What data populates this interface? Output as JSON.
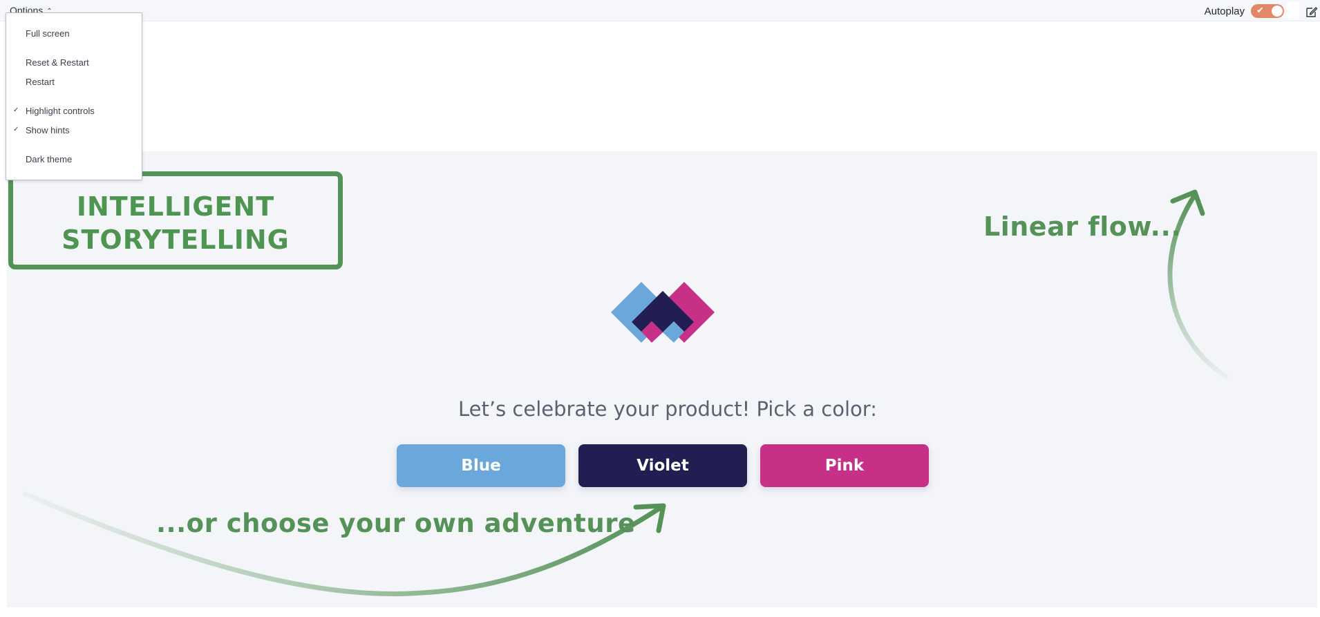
{
  "topbar": {
    "options_label": "Options",
    "chevron_icon": "chevron-up-icon",
    "autoplay_label": "Autoplay",
    "autoplay_on": true,
    "autoplay_check": "✔",
    "edit_icon": "edit-icon"
  },
  "menu": {
    "items": [
      {
        "label": "Full screen",
        "checked": false
      },
      {
        "label": "Reset & Restart",
        "checked": false
      },
      {
        "label": "Restart",
        "checked": false
      },
      {
        "label": "Highlight controls",
        "checked": true
      },
      {
        "label": "Show hints",
        "checked": true
      },
      {
        "label": "Dark theme",
        "checked": false
      }
    ],
    "check_glyph": "✓"
  },
  "stage": {
    "story_line1": "INTELLIGENT",
    "story_line2": "STORYTELLING",
    "linear_flow": "Linear flow...",
    "adventure": "...or choose your own adventure",
    "prompt": "Let’s celebrate your product! Pick a color:",
    "buttons": [
      {
        "label": "Blue",
        "color": "#6aa8dc"
      },
      {
        "label": "Violet",
        "color": "#221e52"
      },
      {
        "label": "Pink",
        "color": "#c63187"
      }
    ]
  },
  "colors": {
    "accent_green": "#559258",
    "toggle_on": "#e2876a",
    "logo_blue": "#6aa8dc",
    "logo_pink": "#c63187",
    "logo_navy": "#221e52"
  }
}
